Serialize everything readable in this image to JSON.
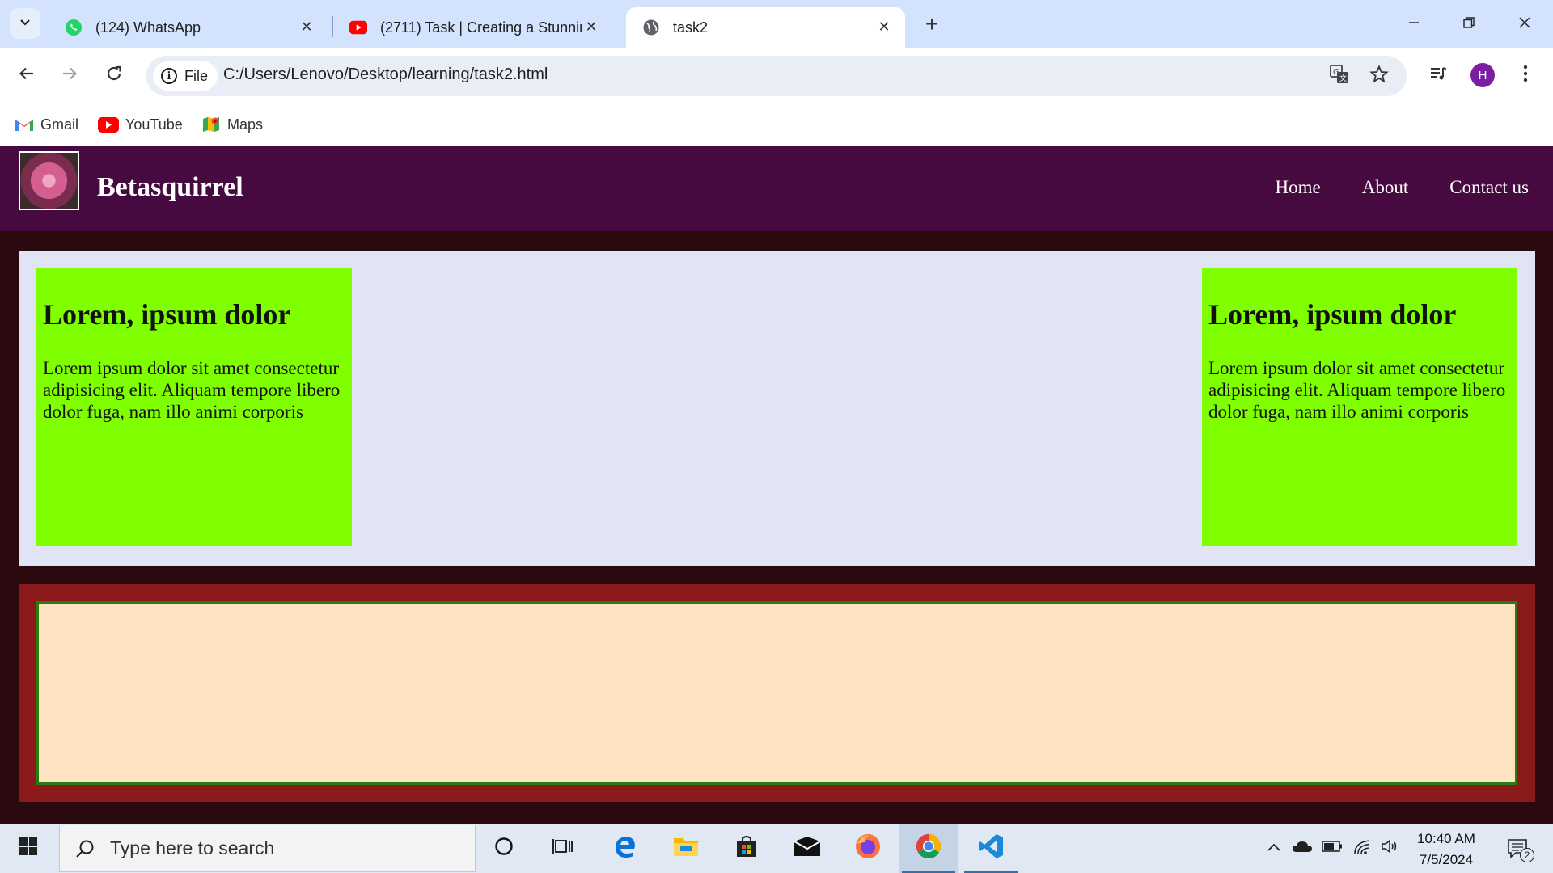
{
  "browser": {
    "tabs": [
      {
        "title": "(124) WhatsApp",
        "icon": "whatsapp-icon",
        "active": false
      },
      {
        "title": "(2711) Task | Creating a Stunnin",
        "icon": "youtube-icon",
        "active": false
      },
      {
        "title": "task2",
        "icon": "globe-icon",
        "active": true
      }
    ],
    "address": {
      "chip_label": "File",
      "url": "C:/Users/Lenovo/Desktop/learning/task2.html"
    },
    "profile_initial": "H",
    "bookmarks": [
      {
        "label": "Gmail",
        "icon": "gmail-icon"
      },
      {
        "label": "YouTube",
        "icon": "youtube-icon"
      },
      {
        "label": "Maps",
        "icon": "maps-icon"
      }
    ]
  },
  "site": {
    "brand": "Betasquirrel",
    "nav": [
      "Home",
      "About",
      "Contact us"
    ],
    "cards": [
      {
        "heading": "Lorem, ipsum dolor",
        "body": "Lorem ipsum dolor sit amet consectetur adipisicing elit. Aliquam tempore libero dolor fuga, nam illo animi corporis"
      },
      {
        "heading": "Lorem, ipsum dolor",
        "body": "Lorem ipsum dolor sit amet consectetur adipisicing elit. Aliquam tempore libero dolor fuga, nam illo animi corporis"
      }
    ]
  },
  "taskbar": {
    "search_placeholder": "Type here to search",
    "time": "10:40 AM",
    "date": "7/5/2024",
    "notification_count": "2"
  },
  "colors": {
    "navbar": "#470a40",
    "page_bg": "#2a0a0e",
    "panel": "#e1e4f5",
    "card": "#7fff00",
    "footer": "#8b1a1a",
    "footer_inner": "#fde3c2",
    "footer_border": "#2b7a12"
  }
}
